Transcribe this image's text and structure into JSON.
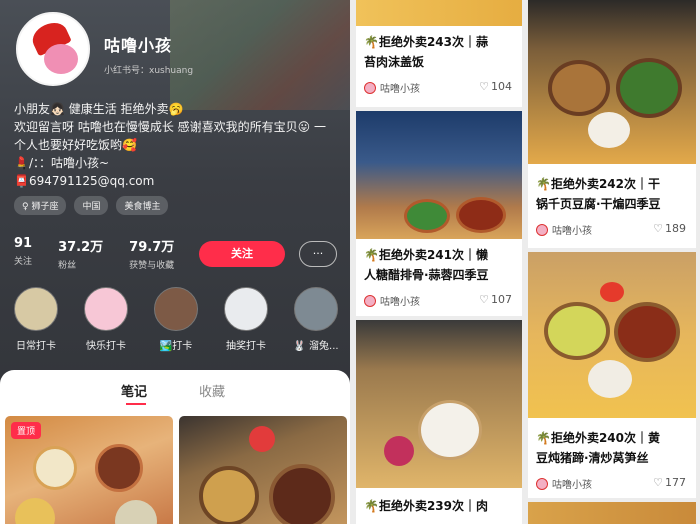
{
  "profile": {
    "nickname": "咕噜小孩",
    "id_text": "小红书号：xushuang",
    "bio": [
      "小朋友👧🏻 健康生活 拒绝外卖🥱",
      "欢迎留言呀 咕噜也在慢慢成长 感谢喜欢我的所有宝贝😛 一",
      "个人也要好好吃饭哟🥰",
      "💄/：：咕噜小孩~",
      "📮694791125@qq.com"
    ],
    "tags": [
      "♀ 狮子座",
      "中国",
      "美食博主"
    ],
    "stats": [
      {
        "value": "91",
        "label": "关注"
      },
      {
        "value": "37.2万",
        "label": "粉丝"
      },
      {
        "value": "79.7万",
        "label": "获赞与收藏"
      }
    ],
    "follow_label": "关注",
    "message_icon": "···",
    "highlights": [
      {
        "label": "日常打卡",
        "color": "#d7c9a4"
      },
      {
        "label": "快乐打卡",
        "color": "#f7c7d6"
      },
      {
        "label": "🏞️打卡",
        "color": "#7d5a46"
      },
      {
        "label": "抽奖打卡",
        "color": "#e9ebee"
      },
      {
        "label": "🐰 溜兔...",
        "color": "#7e8a93"
      }
    ],
    "tabs": {
      "notes": "笔记",
      "collect": "收藏"
    },
    "pin_label": "置顶"
  },
  "feed": {
    "col1": [
      {
        "title_l1": "🌴拒绝外卖243次｜蒜",
        "title_l2": "苔肉沫盖饭",
        "author": "咕噜小孩",
        "likes": "104"
      },
      {
        "title_l1": "🌴拒绝外卖241次｜懒",
        "title_l2": "人糖醋排骨·蒜蓉四季豆",
        "author": "咕噜小孩",
        "likes": "107"
      },
      {
        "title_l1": "🌴拒绝外卖239次｜肉",
        "title_l2": "",
        "author": "",
        "likes": ""
      }
    ],
    "col2": [
      {
        "title_l1": "🌴拒绝外卖242次｜干",
        "title_l2": "锅千页豆腐·干煸四季豆",
        "author": "咕噜小孩",
        "likes": "189"
      },
      {
        "title_l1": "🌴拒绝外卖240次｜黄",
        "title_l2": "豆炖猪蹄·清炒莴笋丝",
        "author": "咕噜小孩",
        "likes": "177"
      }
    ]
  },
  "colors": {
    "accent": "#ff2d4a",
    "follow_btn": "#ff2d4a"
  }
}
